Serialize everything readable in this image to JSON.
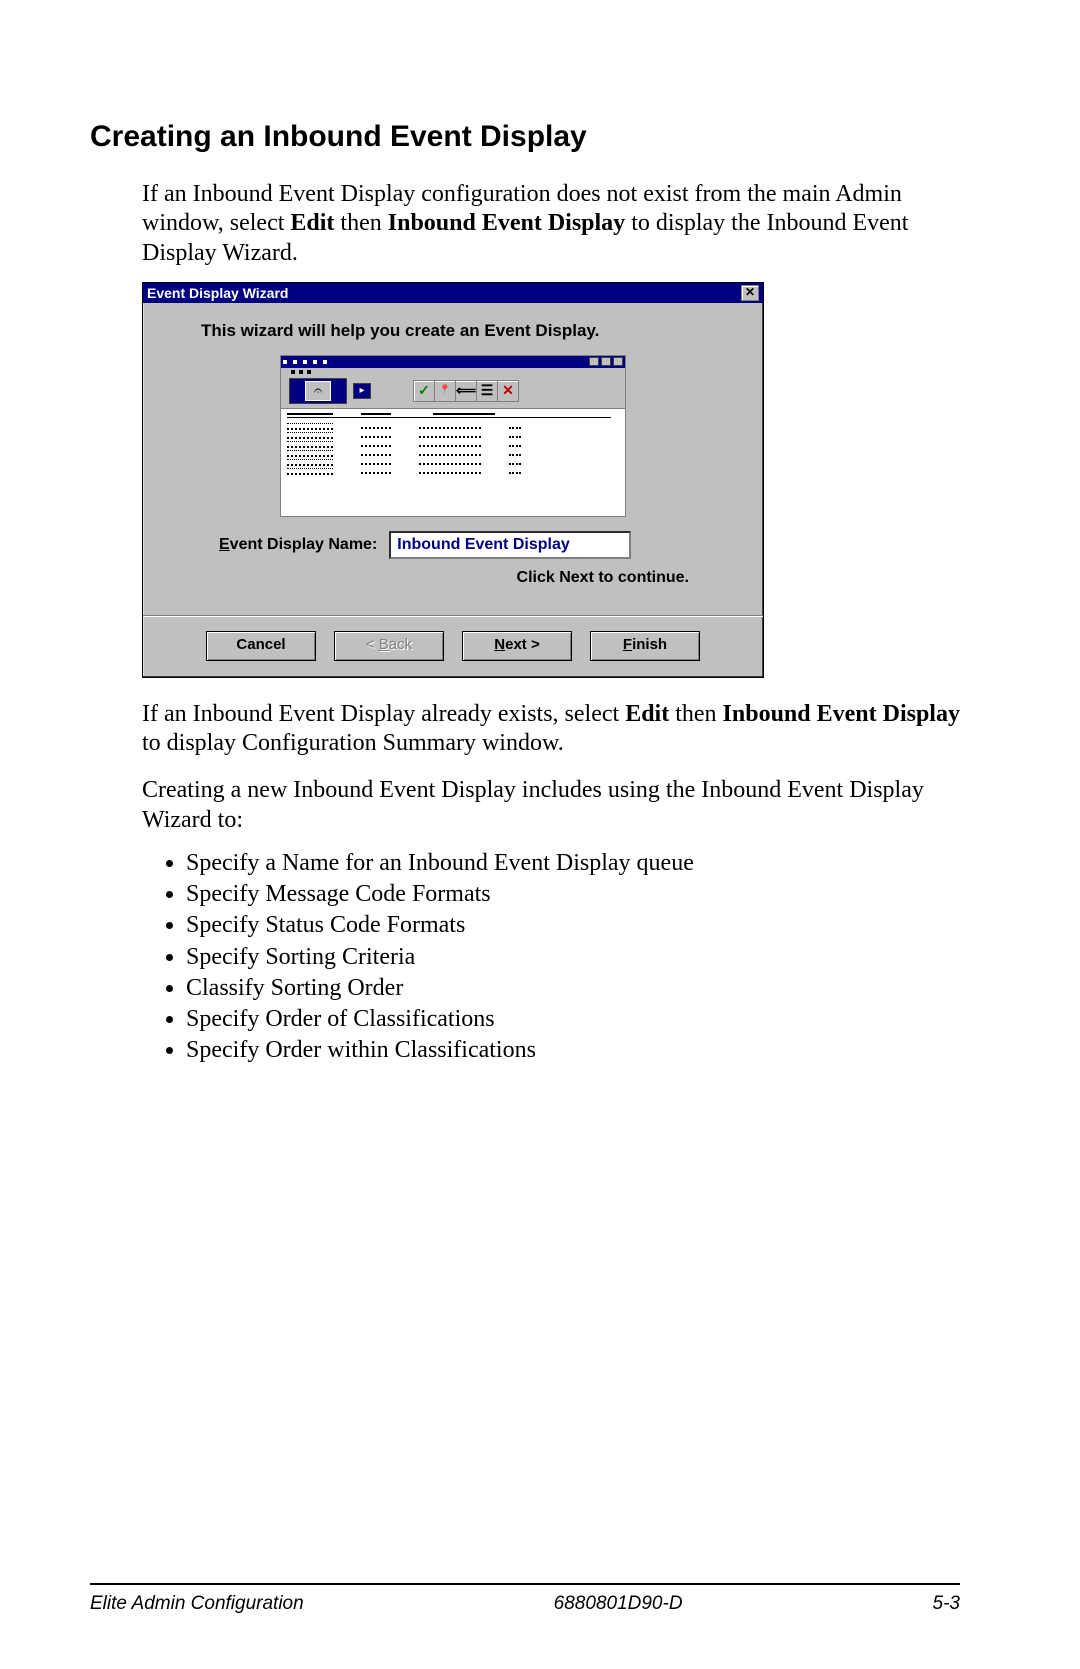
{
  "heading": "Creating an Inbound Event Display",
  "para1_pre": "If an Inbound Event Display configuration does not exist from the main Admin window, select ",
  "para1_b1": "Edit",
  "para1_mid": " then ",
  "para1_b2": "Inbound Event Display",
  "para1_post": " to display the Inbound Event Display Wizard.",
  "dialog": {
    "title": "Event Display Wizard",
    "intro": "This wizard will help you create an Event Display.",
    "name_label_u": "E",
    "name_label_rest": "vent Display Name:",
    "name_value": "Inbound Event Display",
    "continue": "Click Next to continue.",
    "btn_cancel": "Cancel",
    "btn_back_lt": "< ",
    "btn_back_u": "B",
    "btn_back_rest": "ack",
    "btn_next_u": "N",
    "btn_next_rest": "ext >",
    "btn_finish_u": "F",
    "btn_finish_rest": "inish",
    "icons": {
      "check": "✓",
      "pin": "📍",
      "list": "☰",
      "x": "✕",
      "tool": "𝄐",
      "arrow": "▸"
    }
  },
  "para2_pre": "If an Inbound Event Display already exists, select ",
  "para2_b1": "Edit",
  "para2_mid": " then ",
  "para2_b2": "Inbound Event Display",
  "para2_post": " to display Configuration Summary window.",
  "para3": "Creating a new Inbound Event Display includes using the Inbound Event Display Wizard to:",
  "bullets": [
    "Specify a Name for an Inbound Event Display queue",
    "Specify Message Code Formats",
    "Specify Status Code Formats",
    "Specify Sorting Criteria",
    "Classify Sorting Order",
    "Specify Order of Classifications",
    "Specify Order within Classifications"
  ],
  "footer": {
    "left": "Elite Admin Configuration",
    "center": "6880801D90-D",
    "right": "5-3"
  }
}
